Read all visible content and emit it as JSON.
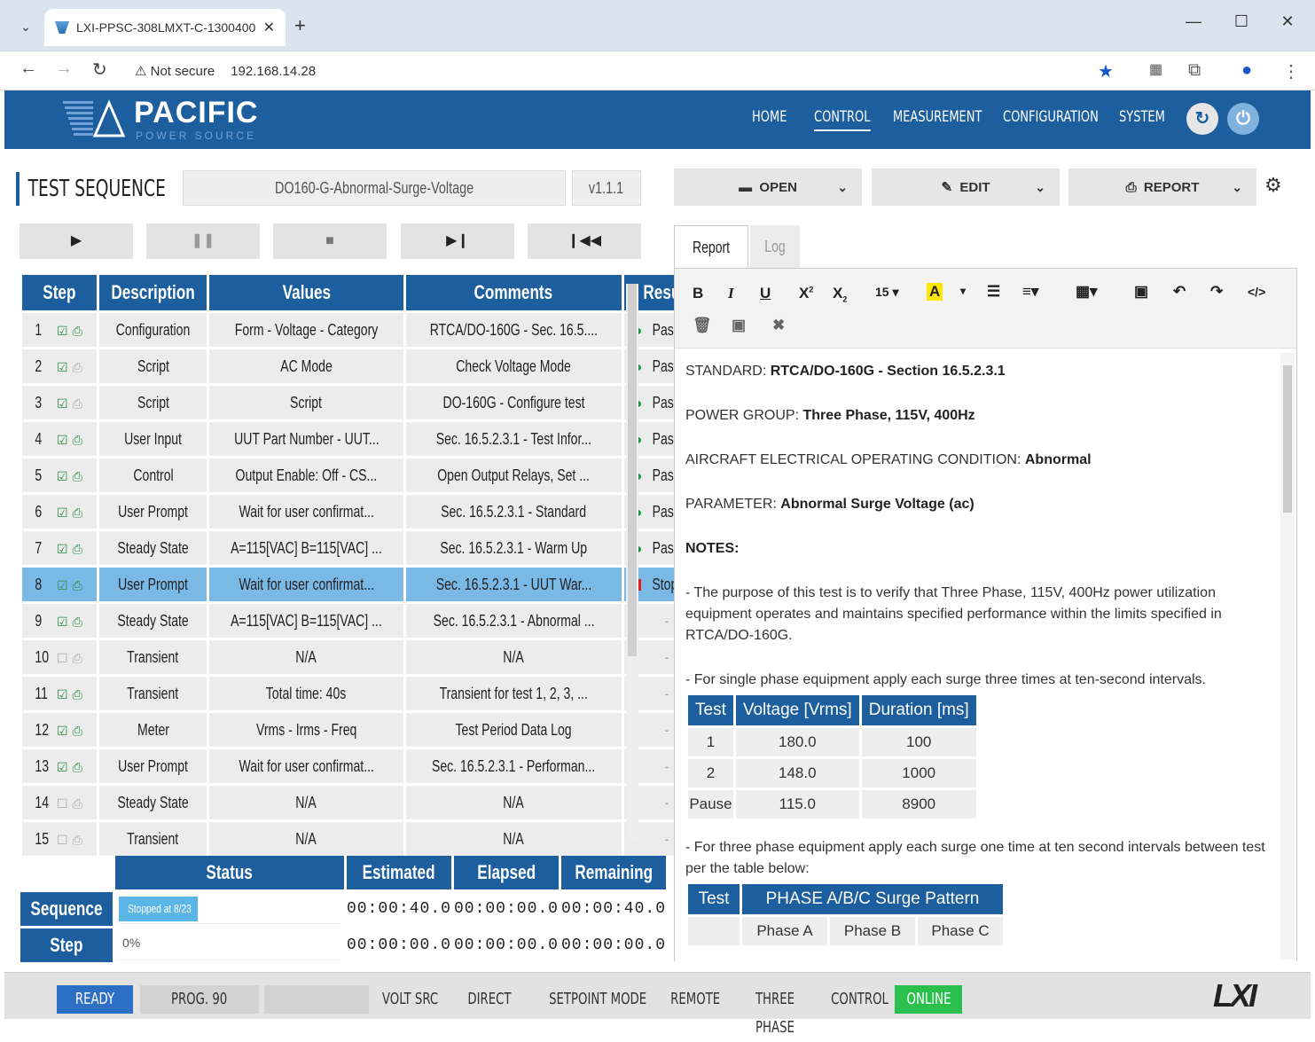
{
  "browser": {
    "tab_title": "LXI-PPSC-308LMXT-C-1300400",
    "not_secure": "Not secure",
    "url": "192.168.14.28"
  },
  "header": {
    "logo_word": "PACIFIC",
    "logo_sub": "POWER SOURCE",
    "nav": [
      "HOME",
      "CONTROL",
      "MEASUREMENT",
      "CONFIGURATION",
      "SYSTEM"
    ],
    "active_nav": "CONTROL"
  },
  "sequence": {
    "title": "TEST SEQUENCE",
    "name": "DO160-G-Abnormal-Surge-Voltage",
    "version": "v1.1.1"
  },
  "table": {
    "headers": [
      "Step",
      "Description",
      "Values",
      "Comments",
      "Result"
    ],
    "rows": [
      {
        "step": "1",
        "desc": "Configuration",
        "values": "Form - Voltage - Category",
        "comments": "RTCA/DO-160G - Sec. 16.5....",
        "result": "Passed",
        "chk": true,
        "prt": true
      },
      {
        "step": "2",
        "desc": "Script",
        "values": "AC Mode",
        "comments": "Check Voltage Mode",
        "result": "Passed",
        "chk": true,
        "prt": false
      },
      {
        "step": "3",
        "desc": "Script",
        "values": "Script",
        "comments": "DO-160G - Configure test",
        "result": "Passed",
        "chk": true,
        "prt": false
      },
      {
        "step": "4",
        "desc": "User Input",
        "values": "UUT Part Number - UUT...",
        "comments": "Sec. 16.5.2.3.1 - Test Infor...",
        "result": "Passed",
        "chk": true,
        "prt": true
      },
      {
        "step": "5",
        "desc": "Control",
        "values": "Output Enable: Off - CS...",
        "comments": "Open Output Relays, Set ...",
        "result": "Passed",
        "chk": true,
        "prt": true
      },
      {
        "step": "6",
        "desc": "User Prompt",
        "values": "Wait for user confirmat...",
        "comments": "Sec. 16.5.2.3.1 - Standard",
        "result": "Passed",
        "chk": true,
        "prt": true
      },
      {
        "step": "7",
        "desc": "Steady State",
        "values": "A=115[VAC] B=115[VAC] ...",
        "comments": "Sec. 16.5.2.3.1 - Warm Up",
        "result": "Passed",
        "chk": true,
        "prt": true
      },
      {
        "step": "8",
        "desc": "User Prompt",
        "values": "Wait for user confirmat...",
        "comments": "Sec. 16.5.2.3.1 - UUT War...",
        "result": "Stopped",
        "chk": true,
        "prt": true,
        "sel": true
      },
      {
        "step": "9",
        "desc": "Steady State",
        "values": "A=115[VAC] B=115[VAC] ...",
        "comments": "Sec. 16.5.2.3.1 - Abnormal ...",
        "result": "-",
        "chk": true,
        "prt": true
      },
      {
        "step": "10",
        "desc": "Transient",
        "values": "N/A",
        "comments": "N/A",
        "result": "-",
        "chk": false,
        "prt": false
      },
      {
        "step": "11",
        "desc": "Transient",
        "values": "Total time: 40s",
        "comments": "Transient for test 1, 2, 3, ...",
        "result": "-",
        "chk": true,
        "prt": true
      },
      {
        "step": "12",
        "desc": "Meter",
        "values": "Vrms - Irms - Freq",
        "comments": "Test Period Data Log",
        "result": "-",
        "chk": true,
        "prt": true
      },
      {
        "step": "13",
        "desc": "User Prompt",
        "values": "Wait for user confirmat...",
        "comments": "Sec. 16.5.2.3.1 - Performan...",
        "result": "-",
        "chk": true,
        "prt": true
      },
      {
        "step": "14",
        "desc": "Steady State",
        "values": "N/A",
        "comments": "N/A",
        "result": "-",
        "chk": false,
        "prt": false
      },
      {
        "step": "15",
        "desc": "Transient",
        "values": "N/A",
        "comments": "N/A",
        "result": "-",
        "chk": false,
        "prt": false
      }
    ]
  },
  "status": {
    "headers": [
      "Status",
      "Estimated",
      "Elapsed",
      "Remaining"
    ],
    "sequence_label": "Sequence",
    "sequence_progress_text": "Stopped at 8/23",
    "sequence_progress": 0.35,
    "sequence_est": "00:00:40.0",
    "sequence_elapsed": "00:00:00.0",
    "sequence_remaining": "00:00:40.0",
    "step_label": "Step",
    "step_progress_text": "0%",
    "step_est": "00:00:00.0",
    "step_elapsed": "00:00:00.0",
    "step_remaining": "00:00:00.0"
  },
  "right": {
    "open": "OPEN",
    "edit": "EDIT",
    "report": "REPORT",
    "tab_report": "Report",
    "tab_log": "Log",
    "font_size": "15",
    "standard_label": "STANDARD:",
    "standard_value": "RTCA/DO-160G - Section 16.5.2.3.1",
    "power_label": "POWER GROUP:",
    "power_value": "Three Phase, 115V, 400Hz",
    "aircraft_label": "AIRCRAFT ELECTRICAL OPERATING CONDITION:",
    "aircraft_value": "Abnormal",
    "param_label": "PARAMETER:",
    "param_value": "Abnormal Surge Voltage (ac)",
    "notes": "NOTES:",
    "note1": "- The purpose of this test is to verify that Three Phase, 115V, 400Hz power utilization equipment operates and maintains specified performance within the limits specified in RTCA/DO-160G.",
    "note2": "- For single phase equipment apply each surge three times at ten-second intervals.",
    "t1_headers": [
      "Test",
      "Voltage [Vrms]",
      "Duration [ms]"
    ],
    "t1_rows": [
      [
        "1",
        "180.0",
        "100"
      ],
      [
        "2",
        "148.0",
        "1000"
      ],
      [
        "Pause",
        "115.0",
        "8900"
      ]
    ],
    "note3": "- For three phase equipment apply each surge one time at ten second intervals between test per the table below:",
    "t2_header_test": "Test",
    "t2_header_pattern": "PHASE A/B/C Surge Pattern",
    "t2_sub": [
      "Phase A",
      "Phase B",
      "Phase C"
    ]
  },
  "statusbar": {
    "ready": "READY",
    "prog": "PROG. 90",
    "volt": "VOLT SRC",
    "direct": "DIRECT",
    "setpoint": "SETPOINT MODE",
    "remote": "REMOTE",
    "three": "THREE PHASE",
    "control": "CONTROL",
    "online": "ONLINE",
    "lxi": "LXI"
  },
  "colors": {
    "brand": "#1c5e9e",
    "passed": "#1a9b4a",
    "stopped": "#e21b1b",
    "online": "#2bbf4e",
    "ready": "#2e6fc6"
  }
}
